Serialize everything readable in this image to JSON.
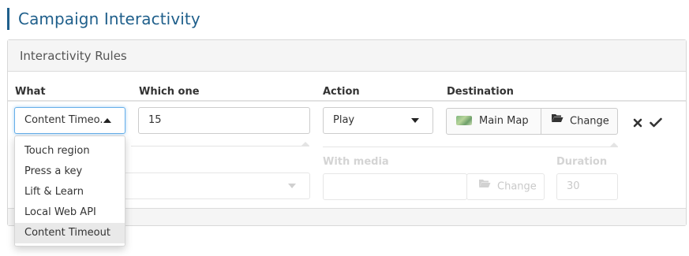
{
  "page": {
    "title": "Campaign Interactivity"
  },
  "panel": {
    "heading": "Interactivity Rules",
    "columns": {
      "what": "What",
      "which": "Which one",
      "action": "Action",
      "destination": "Destination"
    }
  },
  "rule": {
    "what_value": "Content Timeo...",
    "which_value": "15",
    "action_value": "Play",
    "destination": {
      "name": "Main Map",
      "change_label": "Change"
    }
  },
  "sub_row": {
    "with_media_label": "With media",
    "media_change_label": "Change",
    "duration_label": "Duration",
    "duration_placeholder": "30"
  },
  "dropdown": {
    "items": [
      "Touch region",
      "Press a key",
      "Lift & Learn",
      "Local Web API",
      "Content Timeout"
    ],
    "selected": "Content Timeout"
  },
  "icons": {
    "remove": "close-icon",
    "confirm": "check-icon",
    "folder": "folder-open-icon",
    "map": "map-thumbnail"
  },
  "colors": {
    "title": "#1f5f8b",
    "focus": "#66afe9"
  }
}
